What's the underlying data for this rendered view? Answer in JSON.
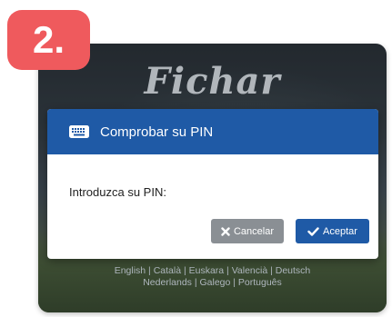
{
  "badge": {
    "label": "2."
  },
  "background": {
    "logo_text": "Fichar",
    "languages_line1": "English | Català | Euskara | Valencià | Deutsch",
    "languages_line2": "Nederlands | Galego | Português"
  },
  "dialog": {
    "title": "Comprobar su PIN",
    "title_icon": "keyboard-icon",
    "pin_label": "Introduzca su PIN:",
    "cancel_label": "Cancelar",
    "cancel_icon": "close-icon",
    "accept_label": "Aceptar",
    "accept_icon": "checkmark-icon"
  },
  "colors": {
    "badge": "#ef5a5d",
    "header": "#1f5aa6",
    "accept_button": "#1f5aa6",
    "cancel_button": "#8a8f94"
  }
}
